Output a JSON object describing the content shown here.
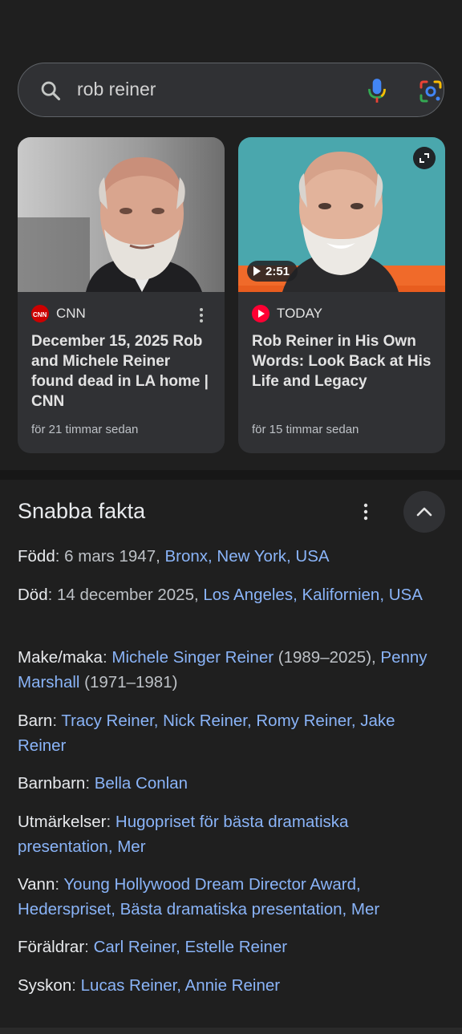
{
  "search": {
    "query": "rob reiner",
    "icons": {
      "search": "search-icon",
      "mic": "mic-icon",
      "lens": "camera-lens-icon"
    },
    "colors": {
      "mic_blue": "#4285f4",
      "mic_red": "#ea4335",
      "mic_yellow": "#fbbc04",
      "mic_green": "#34a853"
    }
  },
  "stories": [
    {
      "source": "CNN",
      "title": "December 15, 2025 Rob and Michele Reiner found dead in LA home | CNN",
      "time": "för 21 timmar sedan"
    },
    {
      "source": "TODAY",
      "title": "Rob Reiner in His Own Words: Look Back at His Life and Legacy",
      "time": "för 15 timmar sedan",
      "duration": "2:51"
    }
  ],
  "facts": {
    "title": "Snabba fakta",
    "rows": [
      {
        "label": "Född",
        "sep": ": ",
        "plain1": "6 mars 1947, ",
        "links": [
          "Bronx, New York, USA"
        ]
      },
      {
        "label": "Död",
        "sep": ": ",
        "plain1": "14 december 2025, ",
        "links": [
          "Los Angeles, Kalifornien, USA"
        ]
      },
      {
        "label": "Make/maka",
        "sep": ": ",
        "link1": "Michele Singer Reiner",
        "plain2": " (1989–2025), ",
        "link2": "Penny Marshall",
        "plain3": " (1971–1981)"
      },
      {
        "label": "Barn",
        "sep": ": ",
        "link1": "Tracy Reiner, Nick Reiner, Romy Reiner, Jake Reiner"
      },
      {
        "label": "Barnbarn",
        "sep": ": ",
        "link1": "Bella Conlan"
      },
      {
        "label": "Utmärkelser",
        "sep": ": ",
        "link1": "Hugopriset för bästa dramatiska presentation, Mer"
      },
      {
        "label": "Vann",
        "sep": ": ",
        "link1": "Young Hollywood Dream Director Award, Hederspriset, Bästa dramatiska presentation, Mer"
      },
      {
        "label": "Föräldrar",
        "sep": ": ",
        "link1": "Carl Reiner, Estelle Reiner"
      },
      {
        "label": "Syskon",
        "sep": ": ",
        "link1": "Lucas Reiner, Annie Reiner"
      }
    ]
  }
}
